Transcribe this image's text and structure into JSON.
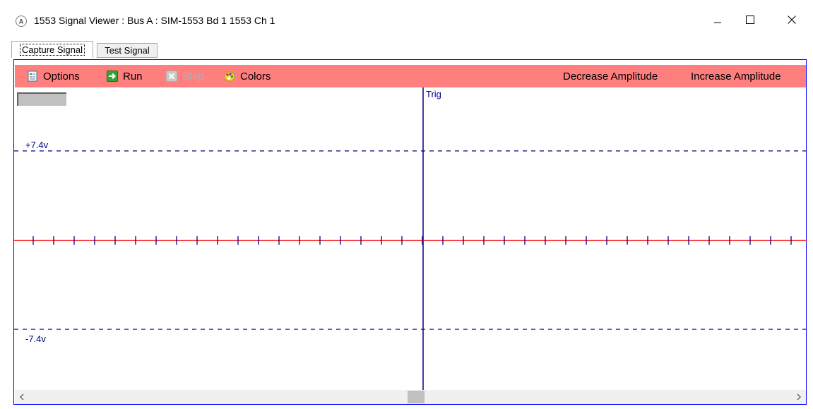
{
  "window": {
    "title": "1553 Signal Viewer : Bus A : SIM-1553 Bd 1 1553 Ch 1",
    "icon": "app-logo-icon"
  },
  "tabs": [
    {
      "label": "Capture Signal",
      "active": true
    },
    {
      "label": "Test Signal",
      "active": false
    }
  ],
  "toolbar": {
    "options_label": "Options",
    "run_label": "Run",
    "stop_label": "Stop",
    "colors_label": "Colors",
    "decrease_label": "Decrease Amplitude",
    "increase_label": "Increase Amplitude",
    "background_color": "#ff7f7f"
  },
  "scope": {
    "trigger_label": "Trig",
    "upper_level_label": "+7.4v",
    "lower_level_label": "-7.4v",
    "signal_color": "#ff0000",
    "grid_color": "#00007f"
  }
}
